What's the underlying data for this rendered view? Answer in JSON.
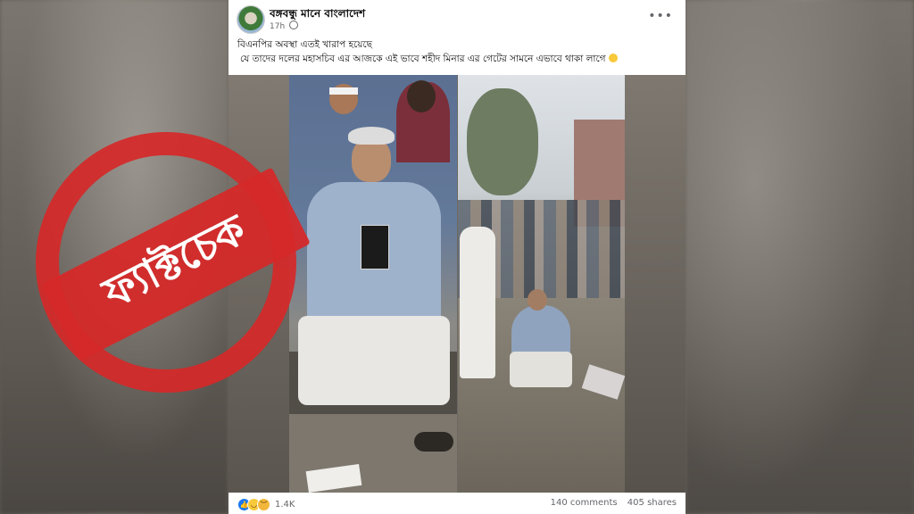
{
  "post": {
    "page_name": "বঙ্গবন্ধু মানে বাংলাদেশ",
    "timestamp": "17h",
    "caption_line1": "বিএনপির অবস্থা এতই খারাপ হয়েছে",
    "caption_line2": "যে তাদের দলের মহাসচিব এর আজকে এই ভাবে শহীদ মিনার এর গেটের সামনে এভাবে থাকা লাগে"
  },
  "stamp": {
    "text": "ফ্যাক্টচেক"
  },
  "footer": {
    "reaction_count": "1.4K",
    "comments": "140 comments",
    "shares": "405 shares"
  },
  "icons": {
    "more": "ellipsis-icon",
    "privacy": "globe-icon",
    "reactions": [
      "like-icon",
      "haha-icon",
      "sad-icon"
    ]
  },
  "colors": {
    "stamp_red": "#d62828",
    "like_blue": "#1877f2"
  }
}
